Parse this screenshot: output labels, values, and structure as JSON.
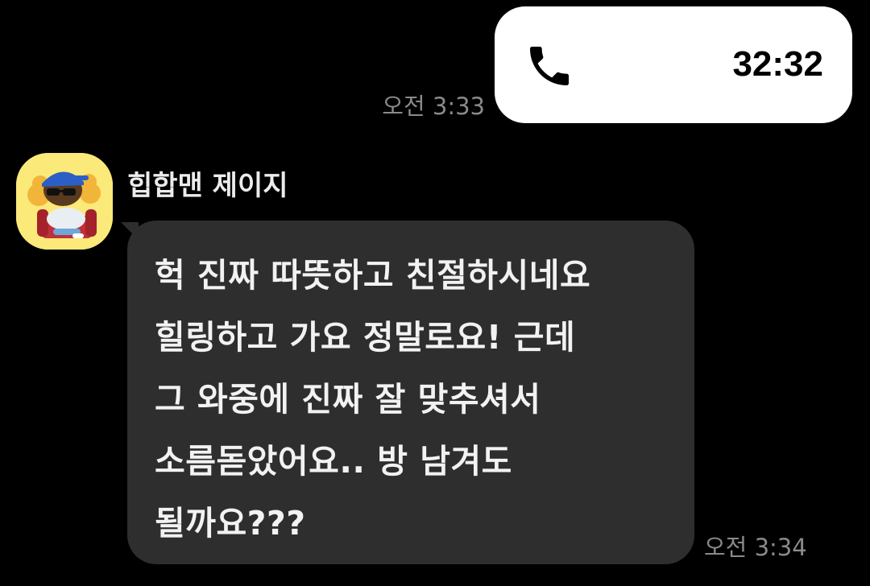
{
  "outgoing_call": {
    "duration": "32:32",
    "time": "오전 3:33",
    "icon": "phone-icon"
  },
  "incoming_message": {
    "sender_name": "힙합맨 제이지",
    "avatar_icon": "hiphop-character-avatar",
    "text": "헉 진짜 따뜻하고 친절하시네요\n힐링하고 가요 정말로요! 근데\n그 와중에 진짜 잘 맞추셔서\n소름돋았어요.. 방 남겨도\n될까요???",
    "time": "오전 3:34"
  },
  "colors": {
    "background": "#000000",
    "outgoing_bubble": "#ffffff",
    "incoming_bubble": "#2e2e2e",
    "avatar_bg": "#fbe97a",
    "timestamp": "#8a8a8a"
  }
}
